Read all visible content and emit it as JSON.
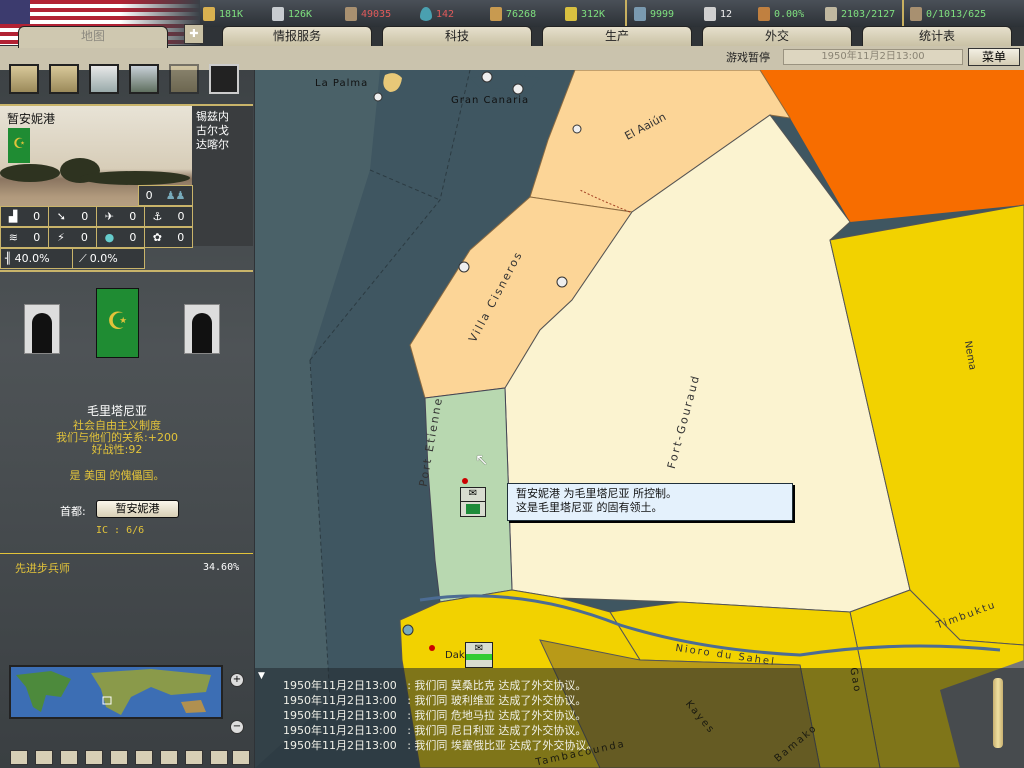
{
  "topbar": {
    "resources": [
      {
        "icon": "energy-icon",
        "value": "181K",
        "color": "green"
      },
      {
        "icon": "metal-icon",
        "value": "126K",
        "color": "green"
      },
      {
        "icon": "rare-materials-icon",
        "value": "49035",
        "color": "red"
      },
      {
        "icon": "oil-icon",
        "value": "142",
        "color": "red"
      },
      {
        "icon": "supplies-icon",
        "value": "76268",
        "color": "green"
      },
      {
        "icon": "money-icon",
        "value": "312K",
        "color": "green"
      },
      {
        "icon": "manpower-icon",
        "value": "9999",
        "color": "green"
      },
      {
        "icon": "diplomacy-icon",
        "value": "12",
        "color": "white"
      },
      {
        "icon": "dissent-icon",
        "value": "0.00%",
        "color": "green"
      },
      {
        "icon": "transport-icon",
        "value": "2103/2127",
        "color": "green"
      },
      {
        "icon": "convoy-icon",
        "value": "0/1013/625",
        "color": "green"
      }
    ]
  },
  "tabs": [
    "地图",
    "情报服务",
    "科技",
    "生产",
    "外交",
    "统计表"
  ],
  "status": {
    "paused": "游戏暂停",
    "date": "1950年11月2日13:00",
    "menu": "菜单"
  },
  "province": {
    "name": "暂安妮港",
    "neighbors": [
      "锡兹内",
      "古尔戈",
      "达喀尔"
    ],
    "units": "0",
    "buildings": [
      "0",
      "0",
      "0",
      "0"
    ],
    "resources": [
      "0",
      "0",
      "0",
      "0"
    ],
    "infra": "40.0%",
    "aa": "0.0%"
  },
  "country": {
    "name": "毛里塔尼亚",
    "government": "社会自由主义制度",
    "relation": "我们与他们的关系:+200",
    "belligerence": "好战性:92",
    "puppet": "是 美国 的傀儡国。",
    "capital_label": "首都:",
    "capital": "暂安妮港",
    "ic": "IC : 6/6"
  },
  "research": {
    "name": "先进步兵师",
    "progress": "34.60%"
  },
  "map_labels": [
    "La Palma",
    "Gran Canaria",
    "El Aaiún",
    "Villa Cisneros",
    "Port Etienne",
    "Fort-Gouraud",
    "Nioro du Sahel",
    "Timbuktu",
    "Bamako",
    "Kayes",
    "Dakar",
    "Nema",
    "Tambacounda",
    "Gao"
  ],
  "tooltip": [
    "暂安妮港 为毛里塔尼亚 所控制。",
    "这是毛里塔尼亚 的固有领土。"
  ],
  "messages": [
    {
      "time": "1950年11月2日13:00",
      "text": ": 我们同 莫桑比克 达成了外交协议。"
    },
    {
      "time": "1950年11月2日13:00",
      "text": ": 我们同 玻利维亚 达成了外交协议。"
    },
    {
      "time": "1950年11月2日13:00",
      "text": ": 我们同 危地马拉 达成了外交协议。"
    },
    {
      "time": "1950年11月2日13:00",
      "text": ": 我们同 尼日利亚 达成了外交协议。"
    },
    {
      "time": "1950年11月2日13:00",
      "text": ": 我们同 埃塞俄比亚 达成了外交协议。"
    }
  ]
}
